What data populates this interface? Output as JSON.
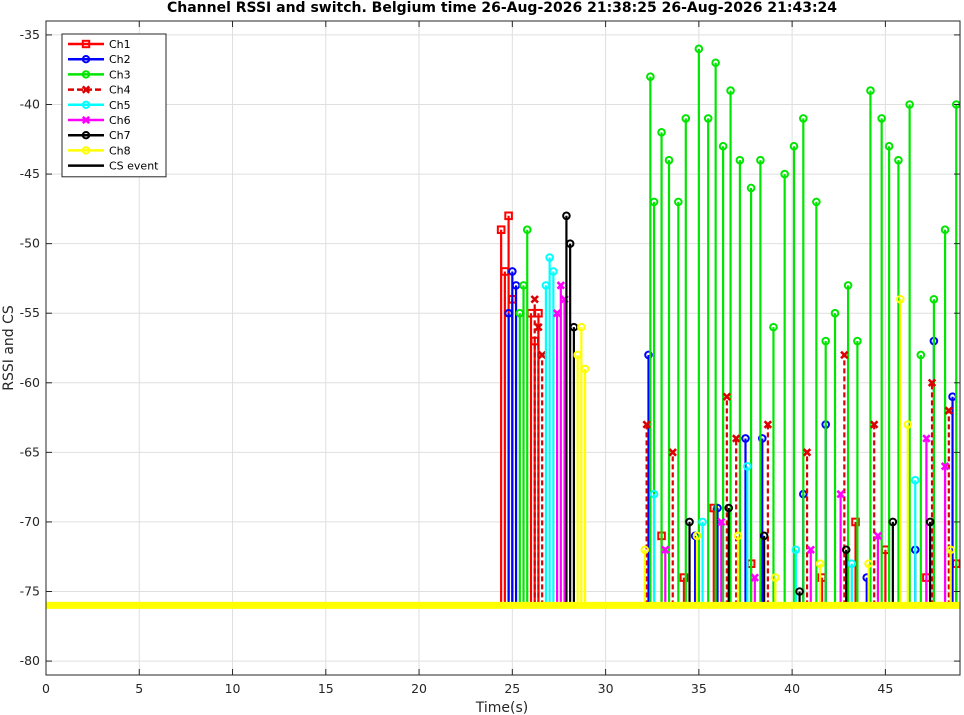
{
  "chart_data": {
    "type": "line",
    "title": "Channel RSSI and switch. Belgium time 26-Aug-2026 21:38:25 26-Aug-2026 21:43:24",
    "xlabel": "Time(s)",
    "ylabel": "RSSI and CS",
    "xlim": [
      0,
      49
    ],
    "ylim": [
      -81,
      -34
    ],
    "x_ticks": [
      0,
      5,
      10,
      15,
      20,
      25,
      30,
      35,
      40,
      45
    ],
    "y_ticks": [
      -35,
      -40,
      -45,
      -50,
      -55,
      -60,
      -65,
      -70,
      -75,
      -80
    ],
    "grid": true,
    "legend_position": "top-left",
    "baseline": -76,
    "series": [
      {
        "name": "Ch1",
        "color": "#ff0000",
        "marker": "square",
        "dash": false,
        "x": [
          24.4,
          24.6,
          24.8,
          25.0,
          26.0,
          26.2,
          26.4,
          33.0,
          34.2,
          35.8,
          37.8,
          41.6,
          43.4,
          45.0,
          47.2,
          48.8
        ],
        "y": [
          -49,
          -52,
          -48,
          -54,
          -55,
          -57,
          -55,
          -71,
          -74,
          -69,
          -73,
          -74,
          -70,
          -72,
          -74,
          -73
        ]
      },
      {
        "name": "Ch2",
        "color": "#0000ff",
        "marker": "circle",
        "dash": false,
        "x": [
          24.8,
          25.0,
          25.2,
          32.3,
          34.8,
          36.0,
          37.5,
          38.4,
          40.6,
          41.8,
          44.0,
          46.6,
          47.6,
          48.6
        ],
        "y": [
          -55,
          -52,
          -53,
          -58,
          -71,
          -69,
          -64,
          -64,
          -68,
          -63,
          -74,
          -72,
          -57,
          -61
        ]
      },
      {
        "name": "Ch3",
        "color": "#00e600",
        "marker": "circle",
        "dash": false,
        "x": [
          25.4,
          25.6,
          25.8,
          32.4,
          32.6,
          33.0,
          33.4,
          33.9,
          34.3,
          35.0,
          35.5,
          35.9,
          36.3,
          36.7,
          37.2,
          37.8,
          38.3,
          39.0,
          39.6,
          40.1,
          40.6,
          41.3,
          41.8,
          42.3,
          43.0,
          43.5,
          44.2,
          44.8,
          45.2,
          45.7,
          46.3,
          46.9,
          47.6,
          48.2,
          48.8
        ],
        "y": [
          -55,
          -53,
          -49,
          -38,
          -47,
          -42,
          -44,
          -47,
          -41,
          -36,
          -41,
          -37,
          -43,
          -39,
          -44,
          -46,
          -44,
          -56,
          -45,
          -43,
          -41,
          -47,
          -57,
          -55,
          -53,
          -57,
          -39,
          -41,
          -43,
          -44,
          -40,
          -58,
          -54,
          -49,
          -40
        ]
      },
      {
        "name": "Ch4",
        "color": "#dd0000",
        "marker": "x",
        "dash": true,
        "x": [
          26.2,
          26.4,
          26.6,
          32.2,
          33.6,
          36.5,
          37.0,
          38.7,
          40.8,
          42.8,
          44.4,
          47.5,
          48.4
        ],
        "y": [
          -54,
          -56,
          -58,
          -63,
          -65,
          -61,
          -64,
          -63,
          -65,
          -58,
          -63,
          -60,
          -62
        ]
      },
      {
        "name": "Ch5",
        "color": "#00ffff",
        "marker": "circle",
        "dash": false,
        "x": [
          26.8,
          27.0,
          27.2,
          32.6,
          35.2,
          37.6,
          40.2,
          43.2,
          46.6
        ],
        "y": [
          -53,
          -51,
          -52,
          -68,
          -70,
          -66,
          -72,
          -73,
          -67
        ]
      },
      {
        "name": "Ch6",
        "color": "#ff00ff",
        "marker": "x",
        "dash": false,
        "x": [
          27.4,
          27.6,
          27.8,
          33.2,
          36.2,
          38.0,
          41.0,
          42.6,
          44.6,
          47.2,
          48.2
        ],
        "y": [
          -55,
          -53,
          -54,
          -72,
          -70,
          -74,
          -72,
          -68,
          -71,
          -64,
          -66
        ]
      },
      {
        "name": "Ch7",
        "color": "#000000",
        "marker": "circle",
        "dash": false,
        "x": [
          27.9,
          28.1,
          28.3,
          34.5,
          36.6,
          38.5,
          40.4,
          42.9,
          45.4,
          47.4
        ],
        "y": [
          -48,
          -50,
          -56,
          -70,
          -69,
          -71,
          -75,
          -72,
          -70,
          -70
        ]
      },
      {
        "name": "Ch8",
        "color": "#ffff00",
        "marker": "circle",
        "dash": false,
        "x": [
          28.5,
          28.7,
          28.9,
          32.1,
          34.9,
          37.1,
          39.1,
          41.5,
          44.1,
          45.8,
          46.2,
          48.5
        ],
        "y": [
          -58,
          -56,
          -59,
          -72,
          -71,
          -71,
          -74,
          -73,
          -73,
          -54,
          -63,
          -72
        ]
      },
      {
        "name": "CS event",
        "color": "#000000",
        "marker": "none",
        "dash": false,
        "x": [],
        "y": []
      }
    ]
  }
}
